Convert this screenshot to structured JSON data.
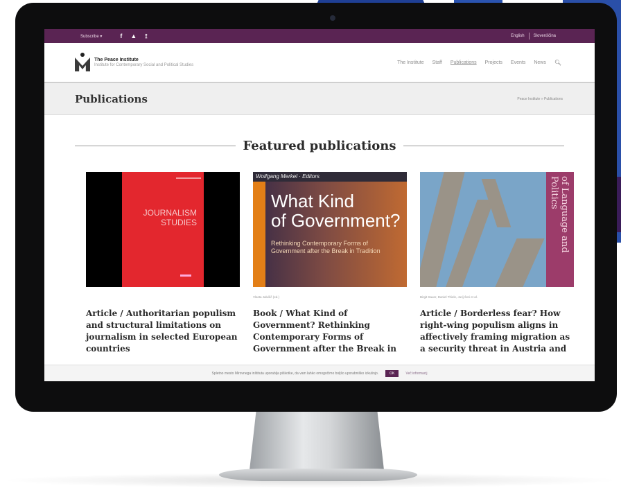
{
  "topbar": {
    "subscribe": "Subscribe ▾",
    "social": [
      "f",
      "▲",
      "⟟"
    ],
    "lang_en": "English",
    "lang_sl": "Slovenščina"
  },
  "header": {
    "org_name": "The Peace Institute",
    "org_tagline": "Institute for Contemporary Social and Political Studies",
    "nav": [
      "The Institute",
      "Staff",
      "Publications",
      "Projects",
      "Events",
      "News"
    ],
    "active_nav": "Publications",
    "search_icon": "search-icon"
  },
  "titlebar": {
    "title": "Publications",
    "breadcrumb": "Peace Institute » Publications"
  },
  "featured": {
    "heading": "Featured publications",
    "cards": [
      {
        "cover_title": "JOURNALISM\nSTUDIES",
        "meta": "",
        "title": "Article / Authoritarian populism and structural limitations on journalism in selected European countries"
      },
      {
        "cover_editors": "Wolfgang Merkel · Editors",
        "cover_title": "What Kind\nof Government?",
        "cover_sub": "Rethinking Contemporary Forms of Government after the Break in Tradition",
        "meta": "Vlasta Jalušič (ed.)",
        "title": "Book / What Kind of Government? Rethinking Contemporary Forms of Government after the Break in"
      },
      {
        "cover_title": "of Language and Politics",
        "meta": "Birgit Sauer, Daniel Thiele, Jurij Šori et al.",
        "title": "Article / Borderless fear? How right-wing populism aligns in affectively framing migration as a security threat in Austria and"
      }
    ]
  },
  "cookie": {
    "text": "Spletno mesto Mirovnega inštituta uporablja piškotke, da vam lahko omogočimo boljšo uporabniško izkušnjo.",
    "ok": "OK",
    "more": "Več informacij"
  },
  "colors": {
    "brand": "#5a2453",
    "journal_red": "#e3272e",
    "book_orange": "#e37f17",
    "journal_purple": "#9c3c6a"
  }
}
